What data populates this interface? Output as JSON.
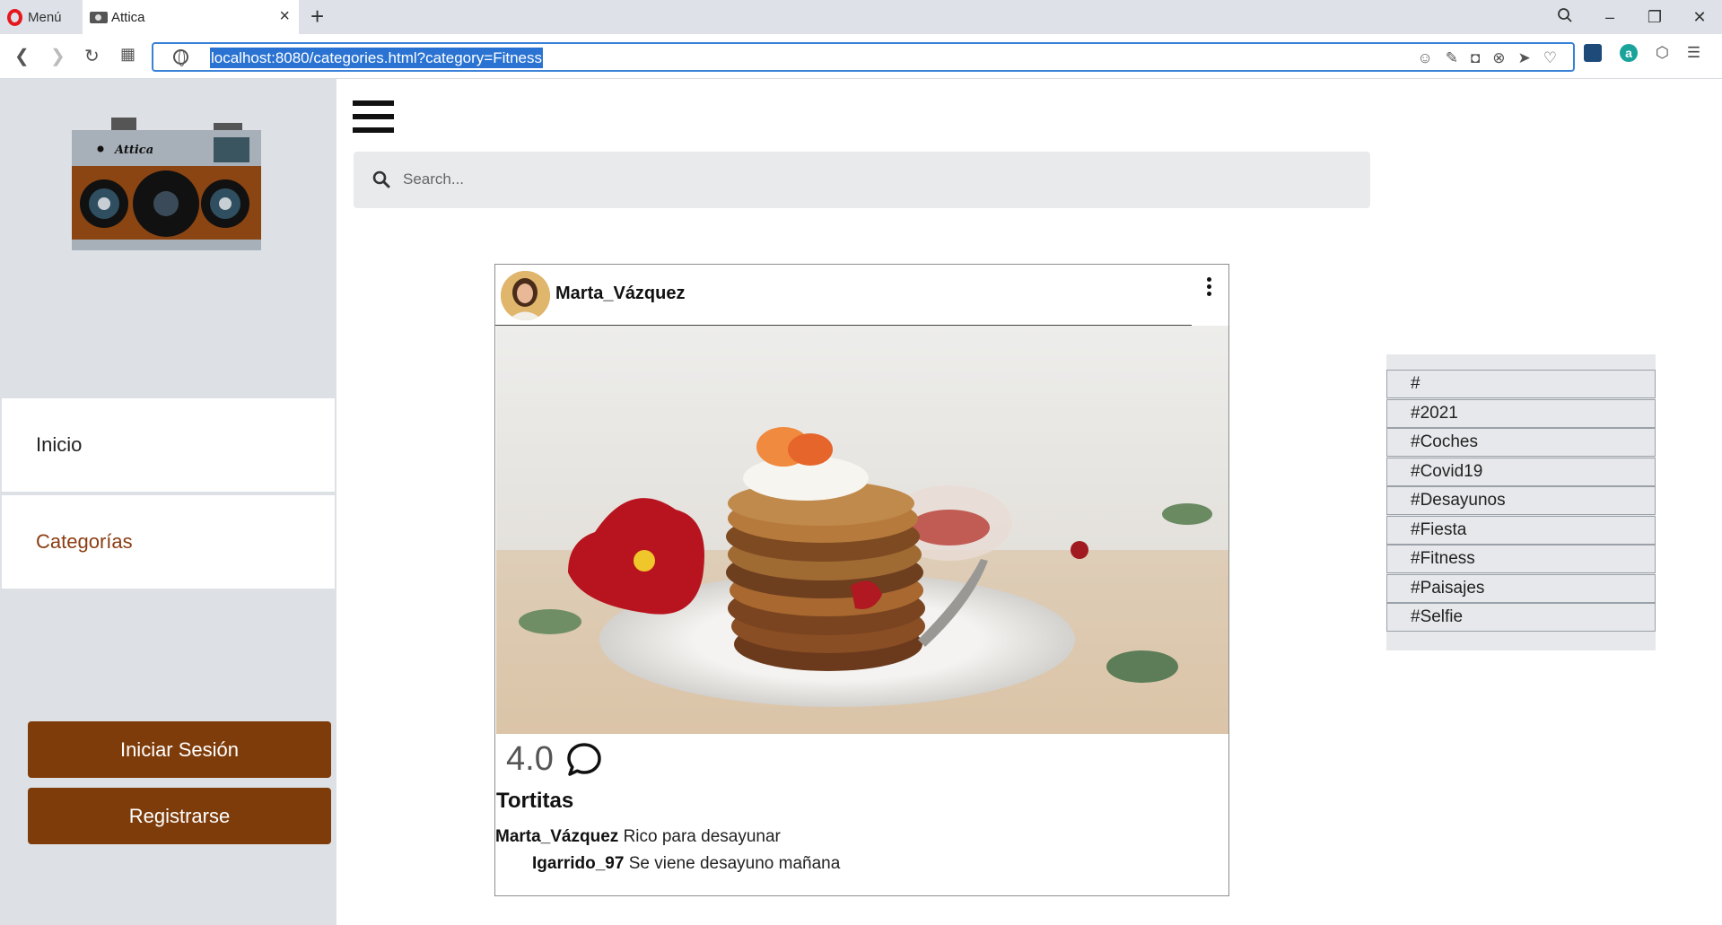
{
  "browser": {
    "menu_label": "Menú",
    "tab_title": "Attica",
    "url": "localhost:8080/categories.html?category=Fitness"
  },
  "sidebar": {
    "logo_text": "Attica",
    "nav": {
      "inicio": "Inicio",
      "categorias": "Categorías"
    },
    "buttons": {
      "login": "Iniciar Sesión",
      "register": "Registrarse"
    }
  },
  "search": {
    "placeholder": "Search..."
  },
  "post": {
    "username": "Marta_Vázquez",
    "rating": "4.0",
    "title": "Tortitas",
    "caption": {
      "author": "Marta_Vázquez",
      "text": "Rico para desayunar"
    },
    "reply": {
      "author": "Igarrido_97",
      "text": "Se viene desayuno mañana"
    }
  },
  "hashtags": [
    "#",
    "#2021",
    "#Coches",
    "#Covid19",
    "#Desayunos",
    "#Fiesta",
    "#Fitness",
    "#Paisajes",
    "#Selfie"
  ],
  "colors": {
    "brand_brown": "#7f3c0b",
    "category_active": "#8a3d12",
    "sidebar_bg": "#dde1e6"
  }
}
